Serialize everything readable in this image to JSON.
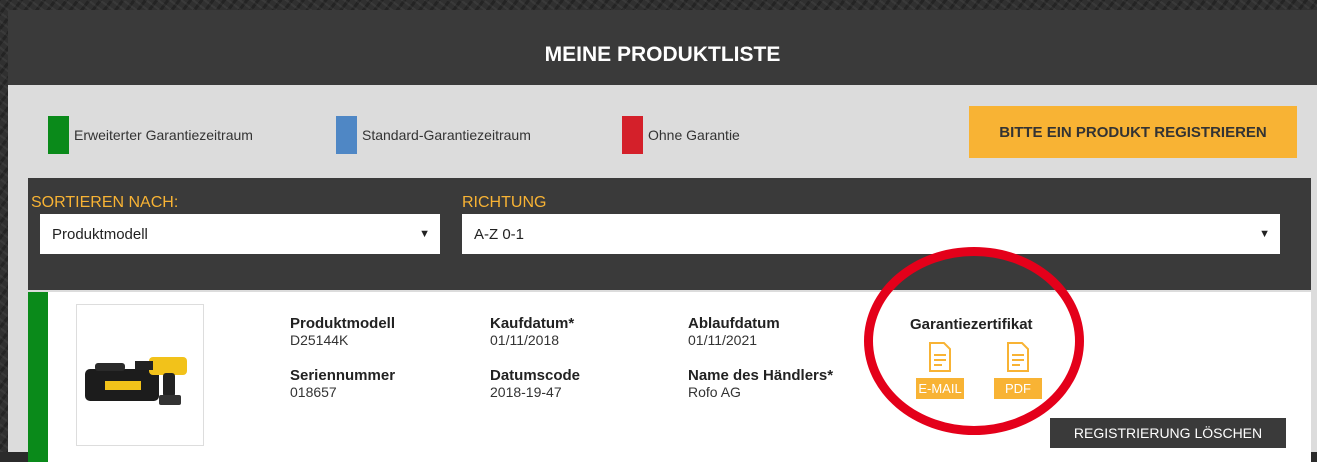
{
  "header": {
    "title": "MEINE PRODUKTLISTE"
  },
  "legend": [
    {
      "label": "Erweiterter Garantiezeitraum",
      "color": "#0a8a1a"
    },
    {
      "label": "Standard-Garantiezeitraum",
      "color": "#4f87c5"
    },
    {
      "label": "Ohne Garantie",
      "color": "#d4202a"
    }
  ],
  "register_button": {
    "label": "BITTE EIN PRODUKT REGISTRIEREN"
  },
  "filters": {
    "sort": {
      "label": "SORTIEREN NACH:",
      "value": "Produktmodell"
    },
    "direction": {
      "label": "RICHTUNG",
      "value": "A-Z 0-1"
    }
  },
  "product": {
    "status_color": "#0a8a1a",
    "image_alt": "DeWALT D25144K Bohrhammer mit Koffer",
    "model_label": "Produktmodell",
    "model_value": "D25144K",
    "serial_label": "Seriennummer",
    "serial_value": "018657",
    "purchase_label": "Kaufdatum*",
    "purchase_value": "01/11/2018",
    "datecode_label": "Datumscode",
    "datecode_value": "2018-19-47",
    "expiry_label": "Ablaufdatum",
    "expiry_value": "01/11/2021",
    "dealer_label": "Name des Händlers*",
    "dealer_value": "Rofo AG",
    "certificate": {
      "title": "Garantiezertifikat",
      "email_label": "E-MAIL",
      "pdf_label": "PDF"
    },
    "delete_label": "REGISTRIERUNG LÖSCHEN"
  },
  "colors": {
    "accent": "#f8b334",
    "dark": "#3a3a3a",
    "highlight": "#e4001a"
  }
}
